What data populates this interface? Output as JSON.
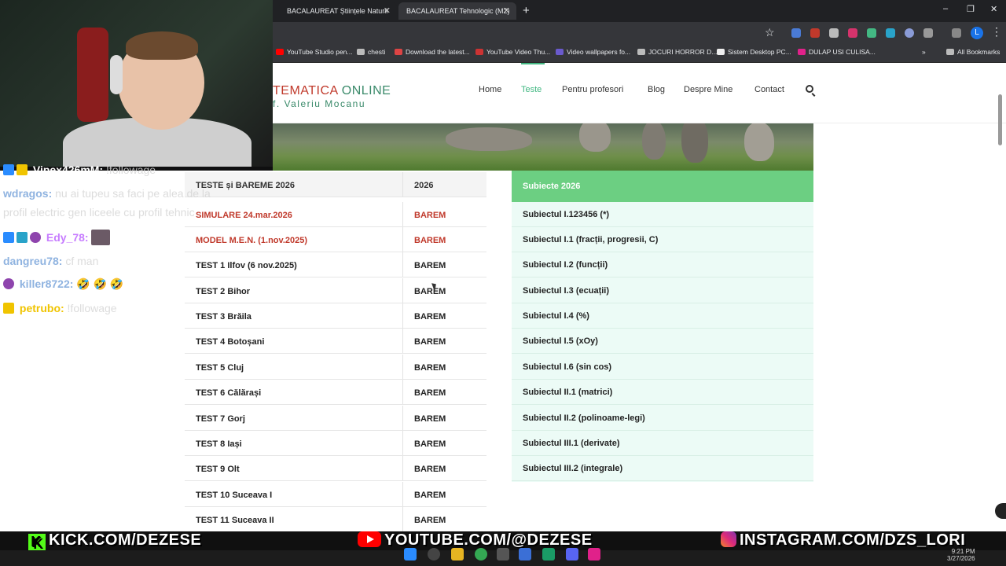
{
  "browser": {
    "tabs": [
      {
        "label": "BACALAUREAT Științele Naturii",
        "active": false
      },
      {
        "label": "BACALAUREAT Tehnologic (M2)",
        "active": true
      }
    ],
    "window_controls": [
      "–",
      "❐",
      "✕"
    ],
    "profile_initial": "L",
    "bookmarks": [
      {
        "label": "YouTube Studio pen...",
        "icon": "youtube-icon",
        "color": "#ff0000"
      },
      {
        "label": "chesti",
        "icon": "folder-icon",
        "color": "#bbbbbb"
      },
      {
        "label": "Download the latest...",
        "icon": "download-icon",
        "color": "#d44"
      },
      {
        "label": "YouTube Video Thu...",
        "icon": "ir-icon",
        "color": "#c33"
      },
      {
        "label": "Video wallpapers fo...",
        "icon": "vw-icon",
        "color": "#6a5acd"
      },
      {
        "label": "JOCURI HORROR D...",
        "icon": "folder-icon",
        "color": "#bbbbbb"
      },
      {
        "label": "Sistem Desktop PC...",
        "icon": "page-icon",
        "color": "#eeeeee"
      },
      {
        "label": "DULAP USI CULISA...",
        "icon": "shop-icon",
        "color": "#e0218a"
      }
    ],
    "all_bookmarks": "All Bookmarks"
  },
  "site": {
    "logo_line1_a": "TEMATICA",
    "logo_line1_b": "ONLINE",
    "logo_line2": "f. Valeriu Mocanu",
    "nav": [
      {
        "label": "Home",
        "active": false
      },
      {
        "label": "Teste",
        "active": true
      },
      {
        "label": "Pentru profesori",
        "active": false
      },
      {
        "label": "Blog",
        "active": false
      },
      {
        "label": "Despre Mine",
        "active": false
      },
      {
        "label": "Contact",
        "active": false
      }
    ]
  },
  "table": {
    "header": {
      "col1": "TESTE și BAREME 2026",
      "col2": "2026"
    },
    "rows": [
      {
        "test": "SIMULARE 24.mar.2026",
        "barem": "BAREM",
        "highlight": true
      },
      {
        "test": "MODEL M.E.N. (1.nov.2025)",
        "barem": "BAREM",
        "highlight": true
      },
      {
        "test": "TEST 1 Ilfov (6 nov.2025)",
        "barem": "BAREM",
        "highlight": false
      },
      {
        "test": "TEST 2 Bihor",
        "barem": "BAREM",
        "highlight": false
      },
      {
        "test": "TEST 3 Brăila",
        "barem": "BAREM",
        "highlight": false
      },
      {
        "test": "TEST 4 Botoșani",
        "barem": "BAREM",
        "highlight": false
      },
      {
        "test": "TEST 5 Cluj",
        "barem": "BAREM",
        "highlight": false
      },
      {
        "test": "TEST 6 Călărași",
        "barem": "BAREM",
        "highlight": false
      },
      {
        "test": "TEST 7 Gorj",
        "barem": "BAREM",
        "highlight": false
      },
      {
        "test": "TEST 8 Iași",
        "barem": "BAREM",
        "highlight": false
      },
      {
        "test": "TEST 9 Olt",
        "barem": "BAREM",
        "highlight": false
      },
      {
        "test": "TEST 10 Suceava I",
        "barem": "BAREM",
        "highlight": false
      },
      {
        "test": "TEST 11 Suceava II",
        "barem": "BAREM",
        "highlight": false
      }
    ]
  },
  "subjects": {
    "title": "Subiecte 2026",
    "items": [
      "Subiectul I.123456 (*)",
      "Subiectul I.1 (fracții, progresii, C)",
      "Subiectul I.2 (funcții)",
      "Subiectul I.3 (ecuații)",
      "Subiectul I.4 (%)",
      "Subiectul I.5 (xOy)",
      "Subiectul I.6 (sin cos)",
      "Subiectul II.1 (matrici)",
      "Subiectul II.2 (polinoame-legi)",
      "Subiectul III.1 (derivate)",
      "Subiectul III.2 (integrale)"
    ]
  },
  "chat": [
    {
      "user": "Vipex426mM:",
      "msg": "!followage",
      "user_color": "#ffffff",
      "badges": [
        "#2a8cff",
        "#f0c400"
      ]
    },
    {
      "user": "wdragos:",
      "msg": "nu ai tupeu sa faci pe alea de la",
      "user_color": "#8fb3e0",
      "badges": []
    },
    {
      "user": "",
      "msg": "profil electric gen liceele cu profil tehnic",
      "user_color": "#ffffff",
      "badges": []
    },
    {
      "user": "Edy_78:",
      "msg": "",
      "user_color": "#c77dff",
      "badges": [
        "#2a8cff",
        "#29a3c9",
        "#8e44ad"
      ]
    },
    {
      "user": "dangreu78:",
      "msg": "cf man",
      "user_color": "#8fb3e0",
      "badges": []
    },
    {
      "user": "killer8722:",
      "msg": "🤣 🤣 🤣",
      "user_color": "#8fb3e0",
      "badges": [
        "#8e44ad"
      ]
    },
    {
      "user": "petrubo:",
      "msg": "!followage",
      "user_color": "#f0c400",
      "badges": [
        "#f0c400"
      ]
    }
  ],
  "socials": {
    "kick": "KICK.COM/DEZESE",
    "youtube": "YOUTUBE.COM/@DEZESE",
    "instagram": "INSTAGRAM.COM/DZS_LORI"
  },
  "taskbar": {
    "time": "9:21 PM",
    "date": "3/27/2026"
  }
}
